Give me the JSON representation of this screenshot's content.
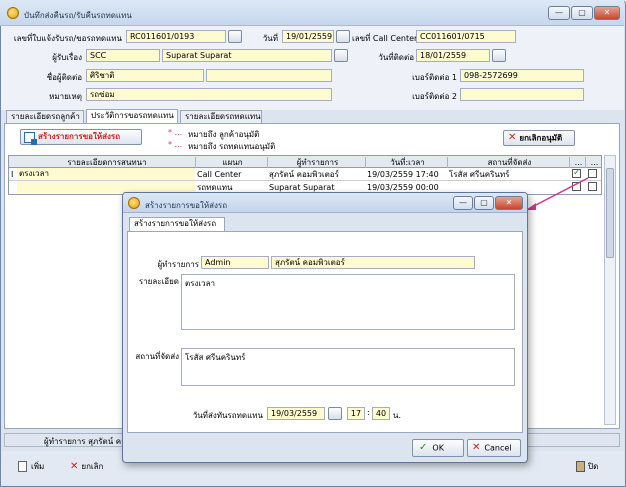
{
  "window": {
    "title": "บันทึกส่งคืนรถ/รับคืนรถทดแทน",
    "min": "—",
    "max": "▢",
    "close": "✕"
  },
  "form": {
    "request_no_label": "เลขที่ใบแจ้งรับรถ/ขอรถทดแทน",
    "request_no": "RC011601/0193",
    "date_label": "วันที่",
    "date": "19/01/2559",
    "callcenter_label": "เลขที่ Call Center",
    "callcenter_no": "CC011601/0715",
    "notifier_label": "ผู้รับเรื่อง",
    "notifier_code": "SCC",
    "notifier_name": "Suparat Suparat",
    "contact_date_label": "วันที่ติดต่อ",
    "contact_date": "18/01/2559",
    "contact_name_label": "ชื่อผู้ติดต่อ",
    "contact_name": "ศิริชาติ",
    "phone1_label": "เบอร์ติดต่อ 1",
    "phone1": "098-2572699",
    "remark_label": "หมายเหตุ",
    "remark": "รถซ่อม",
    "phone2_label": "เบอร์ติดต่อ 2",
    "phone2": ""
  },
  "tabs": [
    {
      "label": "รายละเอียดรถลูกค้า"
    },
    {
      "label": "ประวัติการขอรถทดแทน"
    },
    {
      "label": "รายละเอียดรถทดแทน"
    }
  ],
  "panel": {
    "create_button": "สร้างรายการขอให้ส่งรถ",
    "legend1": "หมายถึง ลูกค้าอนุมัติ",
    "legend2": "หมายถึง รถทดแทนอนุมัติ",
    "legend_mark": "* ...",
    "cancel_approval_button": "ยกเลิกอนุมัติ"
  },
  "grid": {
    "headers": [
      "รายละเอียดการสนทนา",
      "แผนก",
      "ผู้ทำรายการ",
      "วันที่:เวลา",
      "สถานที่จัดส่ง",
      "...",
      "..."
    ],
    "rows": [
      {
        "detail": "ตรงเวลา",
        "dept": "Call Center",
        "user": "สุภรัตน์ คอมพิวเตอร์",
        "datetime": "19/03/2559 17:40",
        "place": "โรสัส ศรีนครินทร์",
        "c1": true,
        "c2": false
      },
      {
        "detail": "",
        "dept": "รถทดแทน",
        "user": "Suparat Suparat",
        "datetime": "19/03/2559 00:00",
        "place": "",
        "c1": false,
        "c2": false
      }
    ]
  },
  "status": {
    "text": "ผู้ทำรายการ สุภรัตน์ คอ"
  },
  "toolbar": {
    "add": "เพิ่ม",
    "cancel": "ยกเลิก",
    "close": "ปิด"
  },
  "dialog": {
    "title": "สร้างรายการขอให้ส่งรถ",
    "tab": "สร้างรายการขอให้ส่งรถ",
    "user_label": "ผู้ทำรายการ",
    "user_code": "Admin",
    "user_name": "สุภรัตน์ คอมพิวเตอร์",
    "detail_label": "รายละเอียด",
    "detail": "ตรงเวลา",
    "place_label": "สถานที่จัดส่ง",
    "place": "โรสัส ศรีนครินทร์",
    "date_label": "วันที่ส่งทันรถทดแทน",
    "date": "19/03/2559",
    "hour": "17",
    "minute": "40",
    "min_unit": "น.",
    "colon": ":",
    "ok": "OK",
    "cancel": "Cancel"
  },
  "colors": {
    "accent": "#d6338a",
    "yellow_field": "#fffbd0",
    "red": "#c8261b",
    "green": "#2e8b27"
  }
}
